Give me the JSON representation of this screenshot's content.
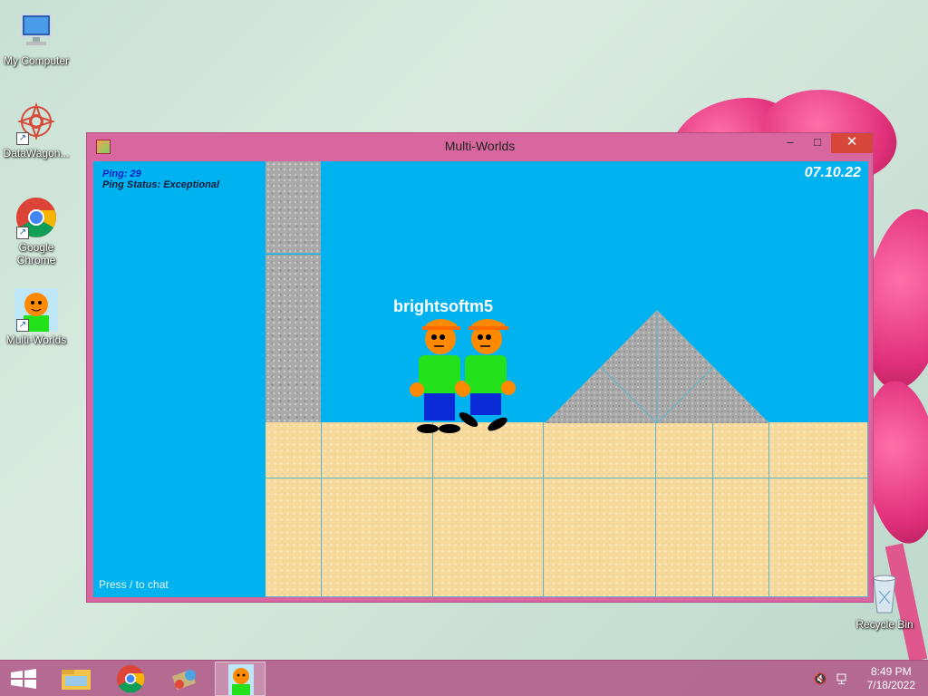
{
  "desktop": {
    "icons": [
      {
        "label": "My Computer",
        "icon": "computer-icon"
      },
      {
        "label": "DataWagon...",
        "icon": "datawagon-icon"
      },
      {
        "label": "Google Chrome",
        "icon": "chrome-icon"
      },
      {
        "label": "Multi-Worlds",
        "icon": "multiworlds-icon"
      },
      {
        "label": "Recycle Bin",
        "icon": "recycle-bin-icon"
      }
    ]
  },
  "window": {
    "title": "Multi-Worlds",
    "minimize": "–",
    "maximize": "□",
    "close": "✕"
  },
  "game": {
    "ping": "Ping: 29",
    "ping_status": "Ping Status: Exceptional",
    "date": "07.10.22",
    "chat_hint": "Press / to chat",
    "player_names": "brightsoftm5"
  },
  "taskbar": {
    "items": [
      "start-icon",
      "file-explorer-icon",
      "chrome-icon",
      "media-icon",
      "multiworlds-icon"
    ],
    "time": "8:49 PM",
    "date": "7/18/2022"
  },
  "colors": {
    "sky": "#00b3f0",
    "window_frame": "#d8679f",
    "close_button": "#d9473a",
    "shirt": "#22e01a",
    "pants": "#0a2ad8",
    "skin": "#ff8a00"
  }
}
